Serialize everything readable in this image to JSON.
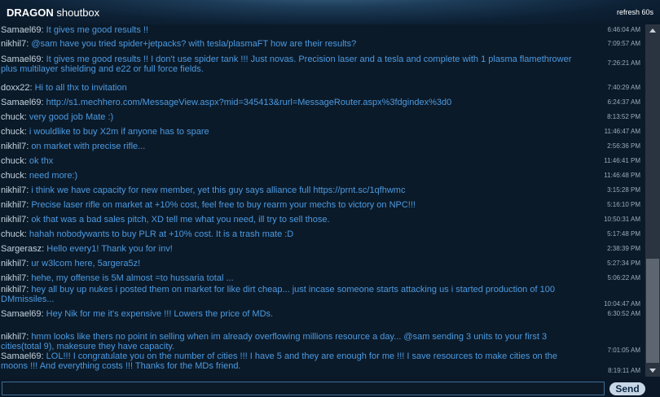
{
  "header": {
    "title_bold": "DRAGON",
    "title_rest": " shoutbox",
    "refresh": "refresh 60s"
  },
  "messages": [
    {
      "user": "Samael69",
      "sep": ": ",
      "text": "It gives me good results !!",
      "time": "6:46:04 AM"
    },
    {
      "user": "nikhil7",
      "sep": ": ",
      "text": "@sam have you tried spider+jetpacks? with tesla/plasmaFT how are their results?",
      "time": "7:09:57 AM"
    },
    {
      "user": "Samael69",
      "sep": ": ",
      "text": "It gives me good results !! I don't use spider tank !!! Just novas. Precision laser and a tesla and complete with 1 plasma flamethrower plus multilayer shielding and e22 or full force fields.",
      "time": "7:26:21 AM"
    },
    {
      "user": "doxx22",
      "sep": ": ",
      "text": "Hi to all thx to invitation",
      "time": "7:40:29 AM"
    },
    {
      "user": "Samael69",
      "sep": ": ",
      "text": "http://s1.mechhero.com/MessageView.aspx?mid=345413&rurl=MessageRouter.aspx%3fdgindex%3d0",
      "time": "6:24:37 AM"
    },
    {
      "user": "chuck",
      "sep": ": ",
      "text": "very good job Mate :)",
      "time": "8:13:52 PM"
    },
    {
      "user": "chuck",
      "sep": ": ",
      "text": "i wouldlike to buy X2m if anyone has to spare",
      "time": "11:46:47 AM"
    },
    {
      "user": "nikhil7",
      "sep": ": ",
      "text": "on market with precise rifle...",
      "time": "2:56:36 PM"
    },
    {
      "user": "chuck",
      "sep": ": ",
      "text": "ok thx",
      "time": "11:46:41 PM"
    },
    {
      "user": "chuck",
      "sep": ": ",
      "text": "need more:)",
      "time": "11:46:48 PM"
    },
    {
      "user": "nikhil7",
      "sep": ": ",
      "text": "i think we have capacity for new member, yet this guy says alliance full https://prnt.sc/1qfhwmc",
      "time": "3:15:28 PM"
    },
    {
      "user": "nikhil7",
      "sep": ": ",
      "text": "Precise laser rifle on market at +10% cost, feel free to buy rearm your mechs to victory on NPC!!!",
      "time": "5:16:10 PM"
    },
    {
      "user": "nikhil7",
      "sep": ": ",
      "text": "ok that was a bad sales pitch, XD tell me what you need, ill try to sell those.",
      "time": "10:50:31 AM"
    },
    {
      "user": "chuck",
      "sep": ": ",
      "text": "hahah nobodywants to buy PLR at +10% cost. It is a trash mate :D",
      "time": "5:17:48 PM"
    },
    {
      "user": "Sargerasz",
      "sep": ": ",
      "text": "Hello every1! Thank you for inv!",
      "time": "2:38:39 PM"
    },
    {
      "user": "nikhil7",
      "sep": ": ",
      "text": "ur w3lcom here, 5argera5z!",
      "time": "5:27:34 PM"
    },
    {
      "user": "nikhil7",
      "sep": ": ",
      "text": "hehe, my offense is 5M almost =to hussaria total ...",
      "time": "5:06:22 AM"
    },
    {
      "user": "nikhil7",
      "sep": ": ",
      "text": "hey all buy up nukes i posted them on market for like dirt cheap... just incase someone starts attacking us i started production of 100 DMmissiles...",
      "time": "10:04:47 AM"
    },
    {
      "user": "Samael69",
      "sep": ": ",
      "text": "Hey Nik for me it's expensive !!! Lowers the price of MDs.",
      "time": "6:30:52 AM"
    },
    {
      "user": "nikhil7",
      "sep": ": ",
      "text": "hmm looks like thers no point in selling when im already overflowing millions resource a day... @sam sending 3 units to your first 3 cities(total 9), makesure they have capacity.",
      "time": "7:01:05 AM"
    },
    {
      "user": "Samael69",
      "sep": ": ",
      "text": "LOL!!! I congratulate you on the number of cities !!! I have 5 and they are enough for me !!! I save resources to make cities on the moons !!! And everything costs !!! Thanks for the MDs friend.",
      "time": "8:19:11 AM"
    }
  ],
  "input": {
    "value": "",
    "placeholder": ""
  },
  "send_label": "Send"
}
